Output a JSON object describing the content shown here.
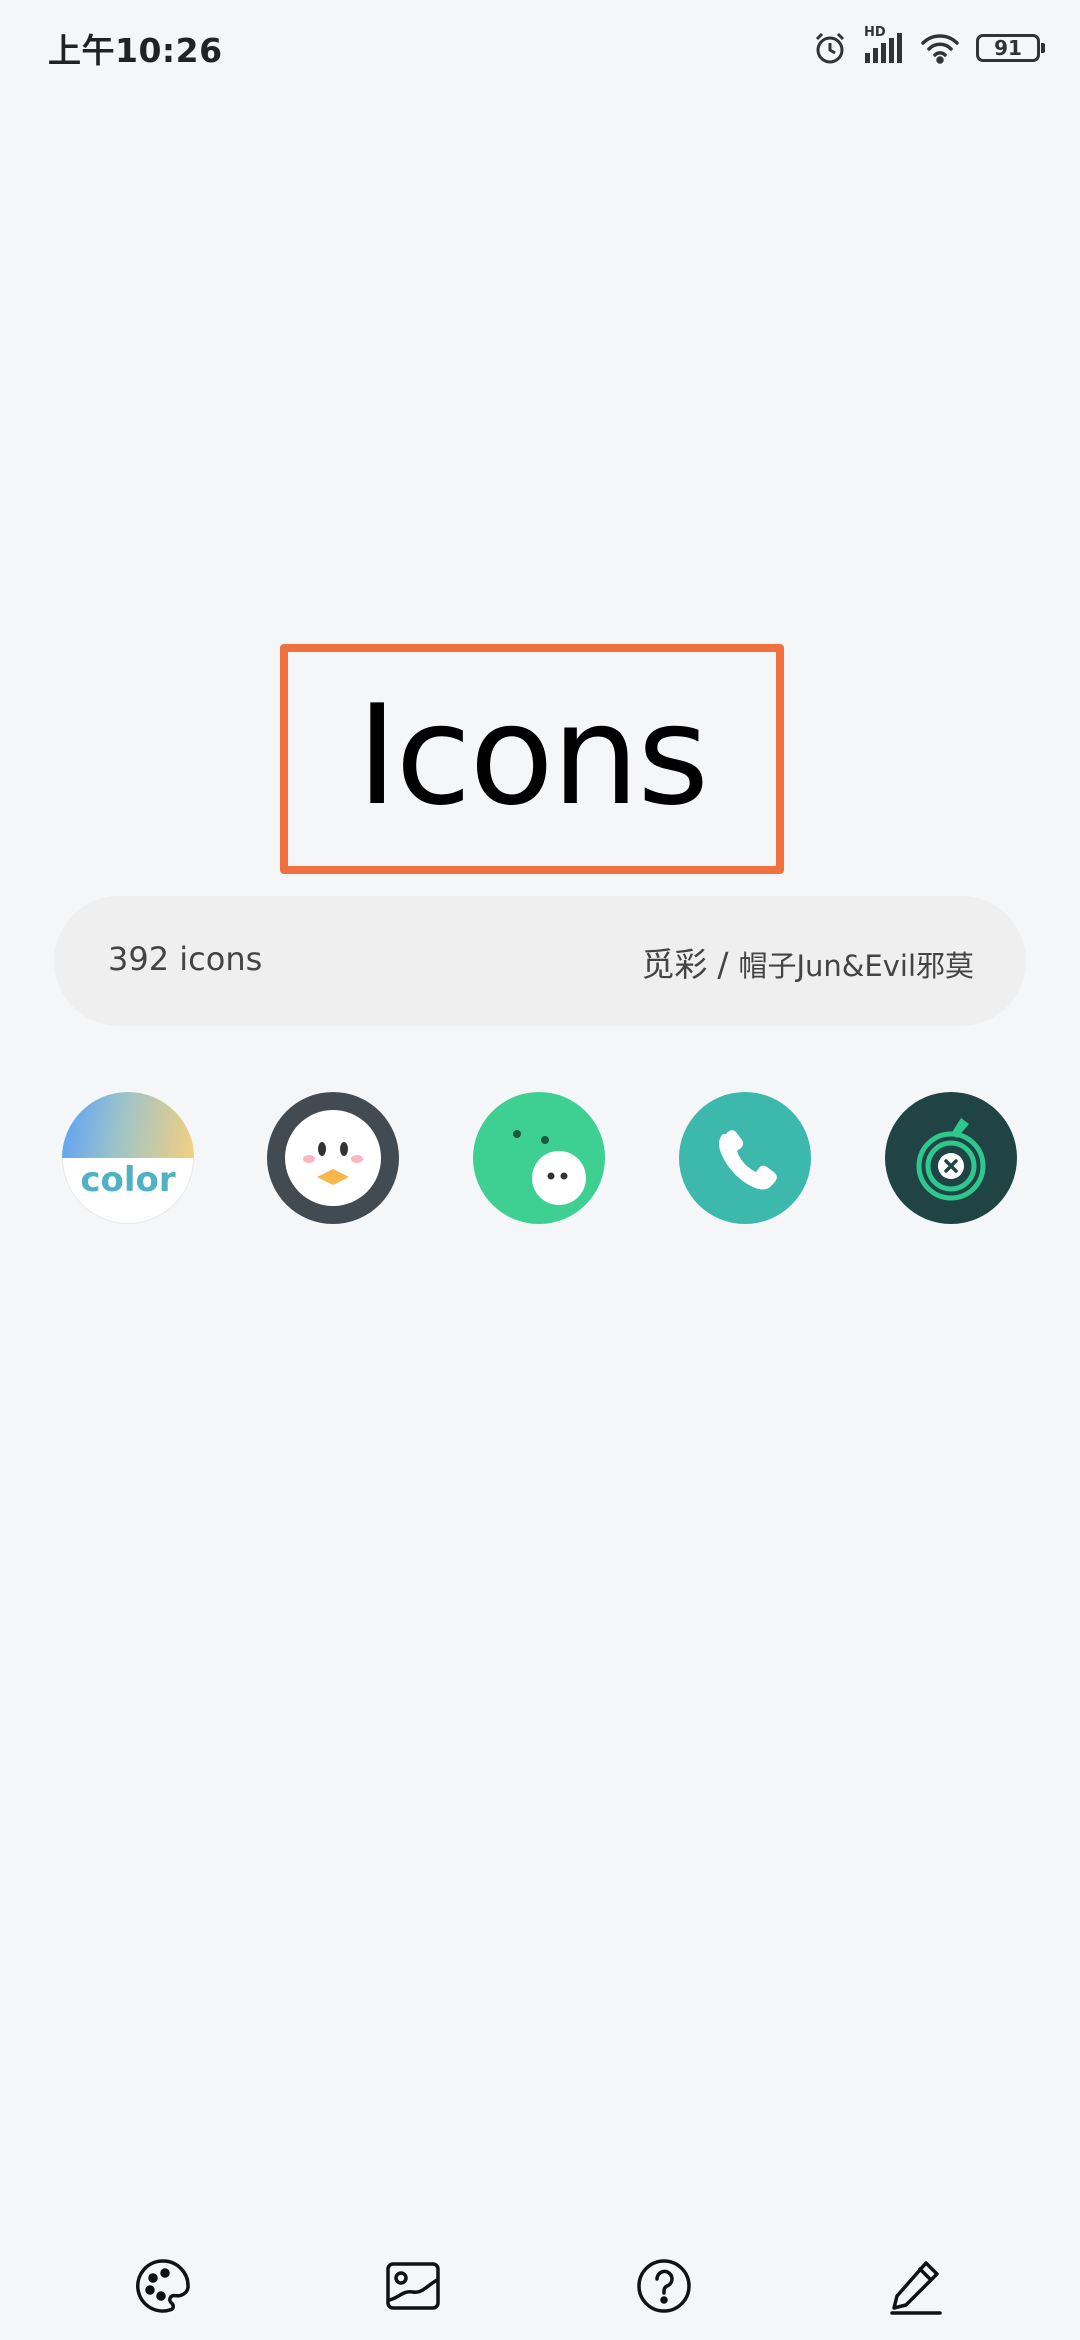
{
  "status_bar": {
    "time": "上午10:26",
    "network_label": "HD",
    "battery": "91"
  },
  "title": "Icons",
  "info": {
    "count": "392 icons",
    "author_primary": "觅彩",
    "separator": "/",
    "author_secondary": "帽子Jun&Evil邪莫"
  },
  "icons": [
    {
      "name": "color",
      "label": "color"
    },
    {
      "name": "penguin"
    },
    {
      "name": "green-face"
    },
    {
      "name": "phone"
    },
    {
      "name": "target-tool"
    }
  ],
  "bottom_nav": [
    {
      "icon": "palette-icon"
    },
    {
      "icon": "wallpaper-icon"
    },
    {
      "icon": "help-icon"
    },
    {
      "icon": "edit-icon"
    }
  ]
}
